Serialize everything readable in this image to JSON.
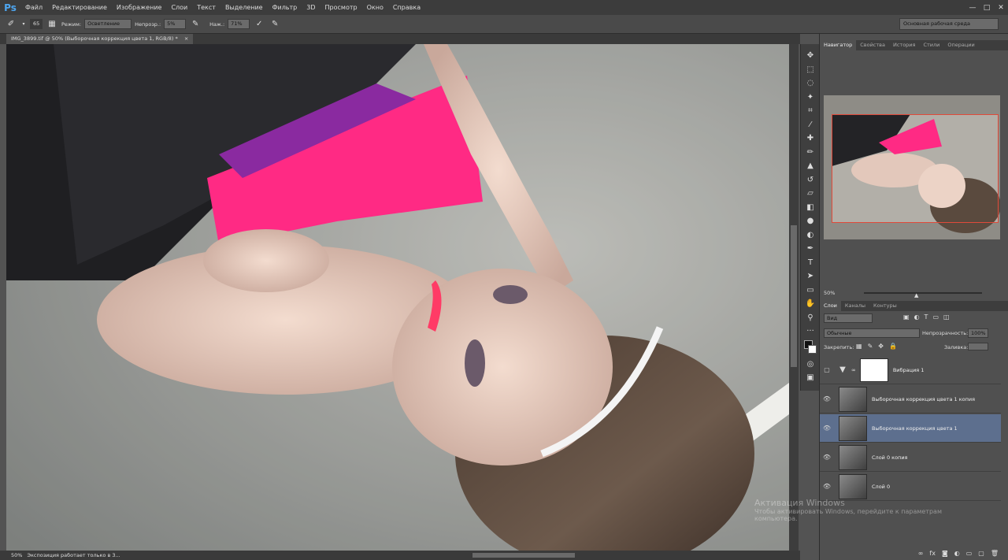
{
  "app": {
    "logo": "Ps"
  },
  "menu": [
    "Файл",
    "Редактирование",
    "Изображение",
    "Слои",
    "Текст",
    "Выделение",
    "Фильтр",
    "3D",
    "Просмотр",
    "Окно",
    "Справка"
  ],
  "window_controls": [
    "—",
    "□",
    "✕"
  ],
  "options": {
    "brush_size": "65",
    "mode_label": "Режим:",
    "mode_value": "Осветление",
    "opacity_label": "Непрозр.:",
    "opacity_value": "5%",
    "flow_label": "Наж.:",
    "flow_value": "71%",
    "workspace": "Основная рабочая среда"
  },
  "document": {
    "tab_title": "IMG_3899.tif @ 50% (Выборочная коррекция цвета 1, RGB/8) *",
    "tab_close": "×"
  },
  "status": {
    "zoom": "50%",
    "message": "Экспозиция работает только в 3..."
  },
  "navigator": {
    "tabs": [
      "Навигатор",
      "Свойства",
      "История",
      "Стили",
      "Операции"
    ],
    "zoom": "50%"
  },
  "layers": {
    "tabs": [
      "Слои",
      "Каналы",
      "Контуры"
    ],
    "kind_filter": "Вид",
    "blend_mode": "Обычные",
    "opacity_label": "Непрозрачность:",
    "opacity_value": "100%",
    "lock_label": "Закрепить:",
    "fill_label": "Заливка:",
    "items": [
      {
        "name": "Вибрация 1",
        "visible": false,
        "type": "adjustment"
      },
      {
        "name": "Выборочная коррекция цвета 1 копия",
        "visible": true,
        "type": "image"
      },
      {
        "name": "Выборочная коррекция цвета 1",
        "visible": true,
        "type": "image",
        "selected": true
      },
      {
        "name": "Слой 0 копия",
        "visible": true,
        "type": "image"
      },
      {
        "name": "Слой 0",
        "visible": true,
        "type": "image"
      }
    ]
  },
  "watermark": {
    "line1": "Активация Windows",
    "line2": "Чтобы активировать Windows, перейдите к параметрам",
    "line3": "компьютера."
  },
  "colors": {
    "accent_pink": "#ff2a84",
    "selection": "#5d6f8e",
    "nav_frame": "#e04a3a"
  }
}
